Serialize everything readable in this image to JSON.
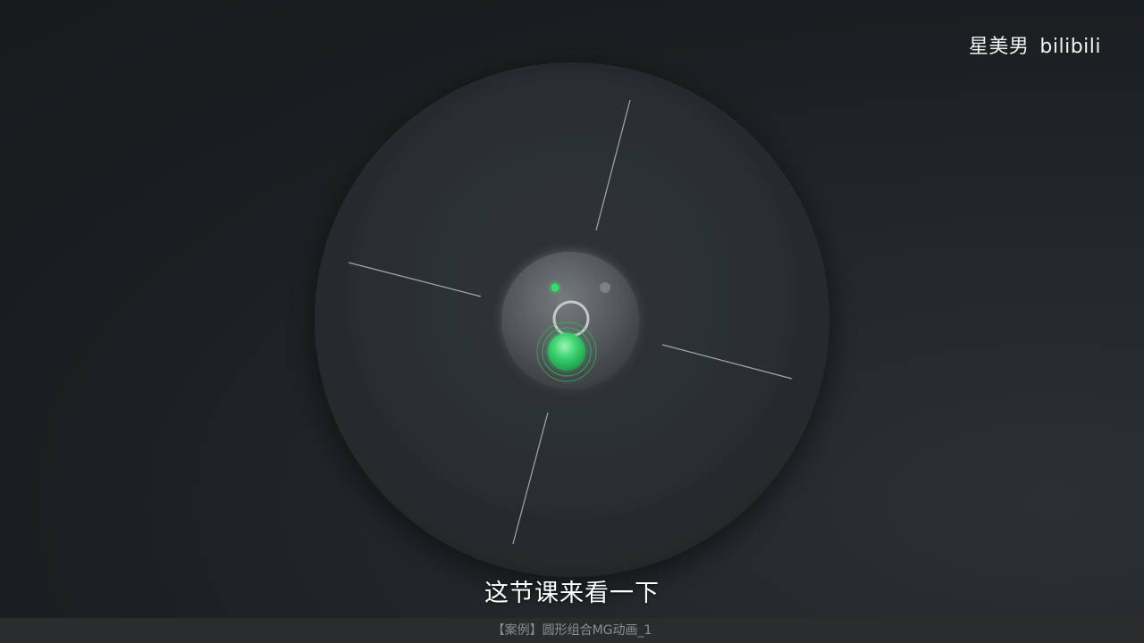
{
  "watermark": {
    "author": "星美男",
    "site": "bilibili"
  },
  "subtitle": "这节课来看一下",
  "video_title": "【案例】圆形组合MG动画_1",
  "colors": {
    "background": "#1b1e20",
    "disc": "#2a2e31",
    "accent_green": "#27c45f",
    "line": "#b9bcbf",
    "bottom_bar": "#2a2c2e"
  }
}
